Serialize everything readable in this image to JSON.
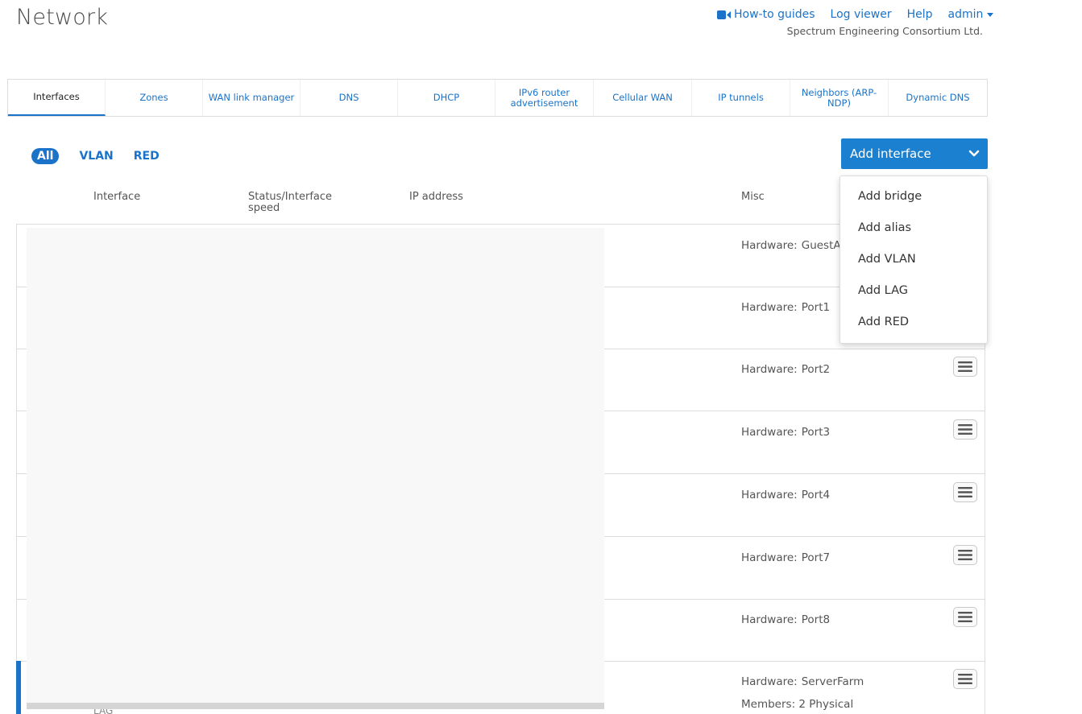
{
  "page": {
    "title": "Network"
  },
  "top_nav": {
    "how_to": "How-to guides",
    "log_viewer": "Log viewer",
    "help": "Help",
    "user": "admin",
    "company": "Spectrum Engineering Consortium Ltd."
  },
  "tabs": [
    {
      "label": "Interfaces",
      "active": true
    },
    {
      "label": "Zones"
    },
    {
      "label": "WAN link manager"
    },
    {
      "label": "DNS"
    },
    {
      "label": "DHCP"
    },
    {
      "label": "IPv6 router advertisement"
    },
    {
      "label": "Cellular WAN"
    },
    {
      "label": "IP tunnels"
    },
    {
      "label": "Neighbors (ARP-NDP)"
    },
    {
      "label": "Dynamic DNS"
    }
  ],
  "filters": {
    "all": "All",
    "vlan": "VLAN",
    "red": "RED"
  },
  "add_interface": {
    "label": "Add interface",
    "menu": [
      "Add bridge",
      "Add alias",
      "Add VLAN",
      "Add LAG",
      "Add RED"
    ]
  },
  "columns": {
    "interface": "Interface",
    "status": "Status/Interface speed",
    "ip": "IP address",
    "misc": "Misc"
  },
  "rows": [
    {
      "hw_label": "Hardware:",
      "hardware": "GuestA"
    },
    {
      "hw_label": "Hardware:",
      "hardware": "Port1"
    },
    {
      "hw_label": "Hardware:",
      "hardware": "Port2"
    },
    {
      "hw_label": "Hardware:",
      "hardware": "Port3"
    },
    {
      "hw_label": "Hardware:",
      "hardware": "Port4"
    },
    {
      "hw_label": "Hardware:",
      "hardware": "Port7"
    },
    {
      "hw_label": "Hardware:",
      "hardware": "Port8"
    },
    {
      "hw_label": "Hardware:",
      "hardware": "ServerFarm",
      "members": "Members: 2 Physical",
      "selected": true
    }
  ],
  "partial_text": "LAG",
  "colors": {
    "accent": "#1a73c8",
    "button": "#1a80cf"
  },
  "icons": {
    "video": "video-camera-icon",
    "caret": "caret-down-icon",
    "chevron": "chevron-down-icon",
    "menu": "hamburger-menu-icon"
  }
}
